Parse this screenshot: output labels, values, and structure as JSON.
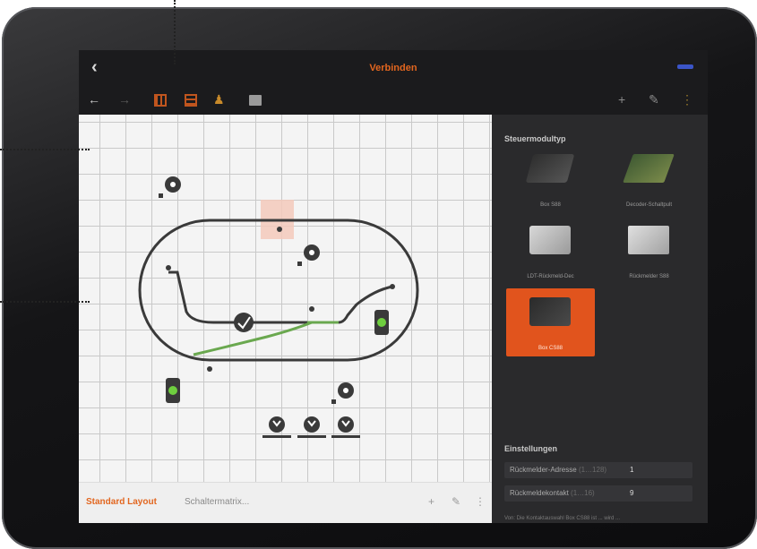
{
  "window": {
    "title": "Verbinden",
    "back_icon": "chevron-left-icon"
  },
  "toolbar": {
    "icons_left": [
      "arrow-left-icon",
      "arrow-right-icon",
      "grid-icon",
      "grid-edit-icon",
      "person-icon",
      "image-icon"
    ],
    "icons_right": [
      "plus-icon",
      "pencil-icon",
      "more-icon"
    ]
  },
  "bottom_bar": {
    "active_tab": "Standard Layout",
    "inactive_tab": "Schaltermatrix..."
  },
  "sidebar": {
    "module_type_title": "Steuermodultyp",
    "modules": [
      {
        "label": "Box S88",
        "selected": false
      },
      {
        "label": "Decoder-Schaltpult",
        "selected": false
      },
      {
        "label": "LDT-Rückmeld-Dec",
        "selected": false
      },
      {
        "label": "Rückmelder S88",
        "selected": false
      },
      {
        "label": "Box CS88",
        "selected": true
      }
    ],
    "settings_title": "Einstellungen",
    "settings": [
      {
        "label": "Rückmelder-Adresse",
        "hint": "(1…128)",
        "value": "1"
      },
      {
        "label": "Rückmeldekontakt",
        "hint": "(1…16)",
        "value": "9"
      }
    ],
    "note": "Von: Die Kontaktauswahl Box CS88 ist ... wird ..."
  },
  "colors": {
    "accent": "#e2661f",
    "selected_card": "#e1541d",
    "track": "#3a3a3a",
    "track_green": "#6aa84f"
  }
}
